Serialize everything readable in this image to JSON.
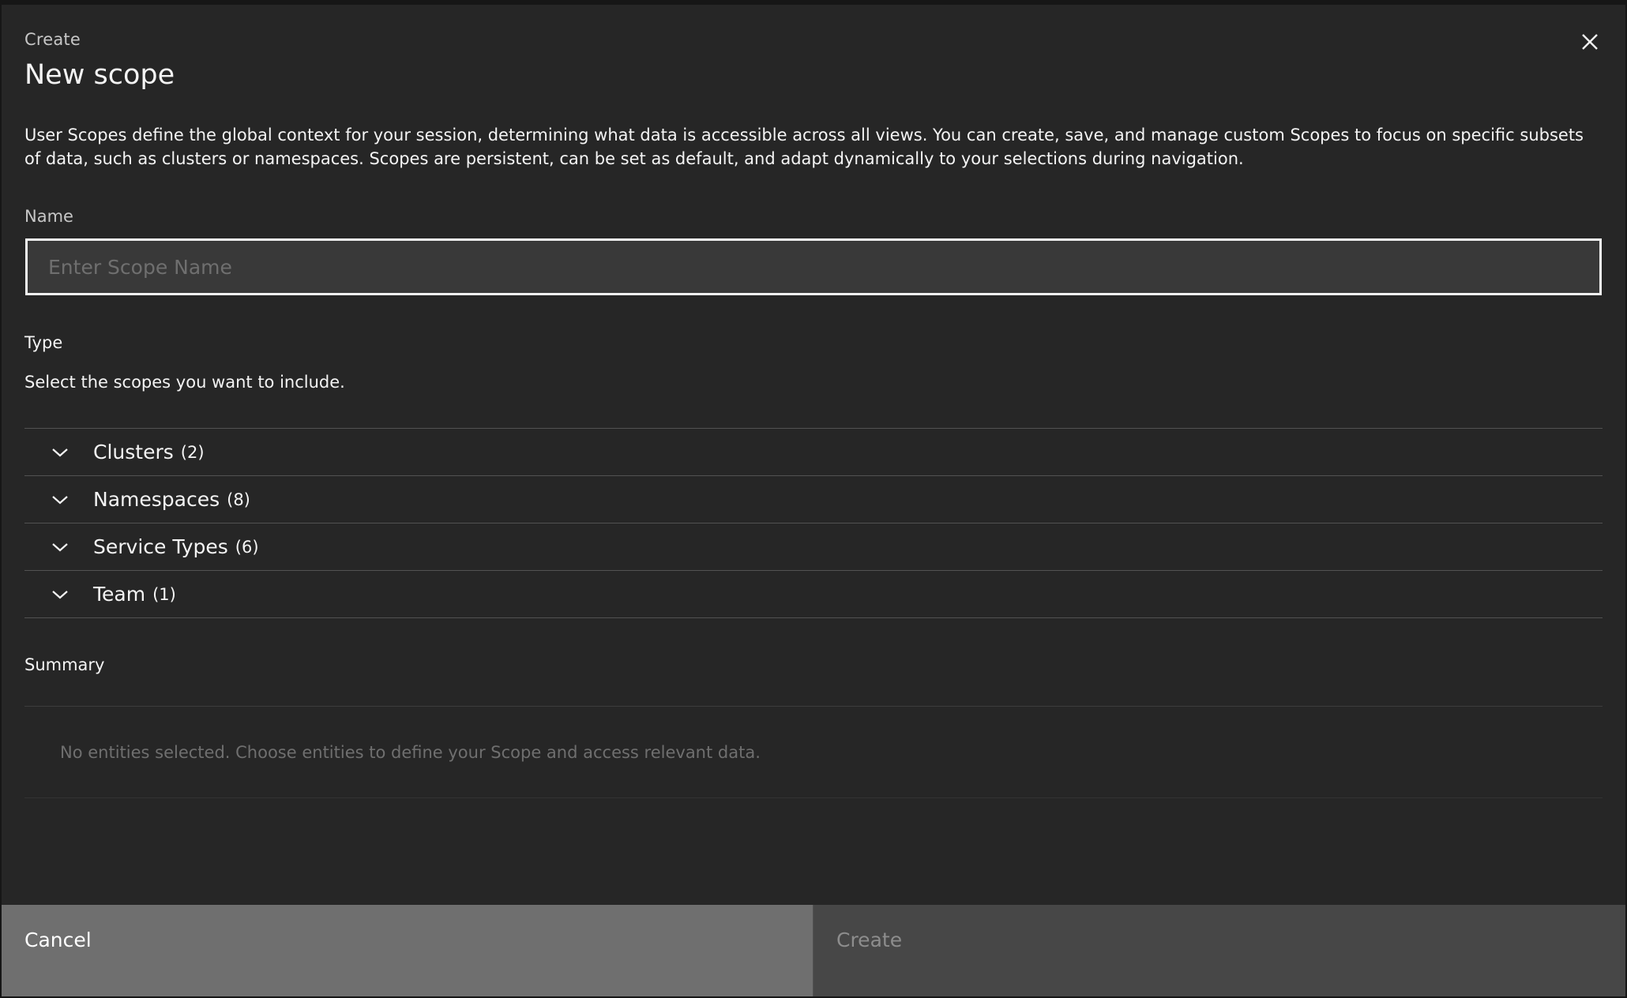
{
  "modal": {
    "label": "Create",
    "title": "New scope",
    "close_icon": "close-icon",
    "description": "User Scopes define the global context for your session, determining what data is accessible across all views. You can create, save, and manage custom Scopes to focus on specific subsets of data, such as clusters or namespaces. Scopes are persistent, can be set as default, and adapt dynamically to your selections during navigation."
  },
  "name_field": {
    "label": "Name",
    "value": "",
    "placeholder": "Enter Scope Name"
  },
  "type_section": {
    "label": "Type",
    "helper": "Select the scopes you want to include.",
    "items": [
      {
        "title": "Clusters",
        "count": "(2)",
        "icon": "chevron-down-icon"
      },
      {
        "title": "Namespaces",
        "count": "(8)",
        "icon": "chevron-down-icon"
      },
      {
        "title": "Service Types",
        "count": "(6)",
        "icon": "chevron-down-icon"
      },
      {
        "title": "Team",
        "count": "(1)",
        "icon": "chevron-down-icon"
      }
    ]
  },
  "summary": {
    "label": "Summary",
    "empty_text": "No entities selected. Choose entities to define your Scope and access relevant data."
  },
  "footer": {
    "cancel_label": "Cancel",
    "create_label": "Create"
  },
  "colors": {
    "background": "#262626",
    "field": "#393939",
    "cancel_button": "#6f6f6f",
    "create_button_disabled": "#474747",
    "divider": "#525252"
  }
}
